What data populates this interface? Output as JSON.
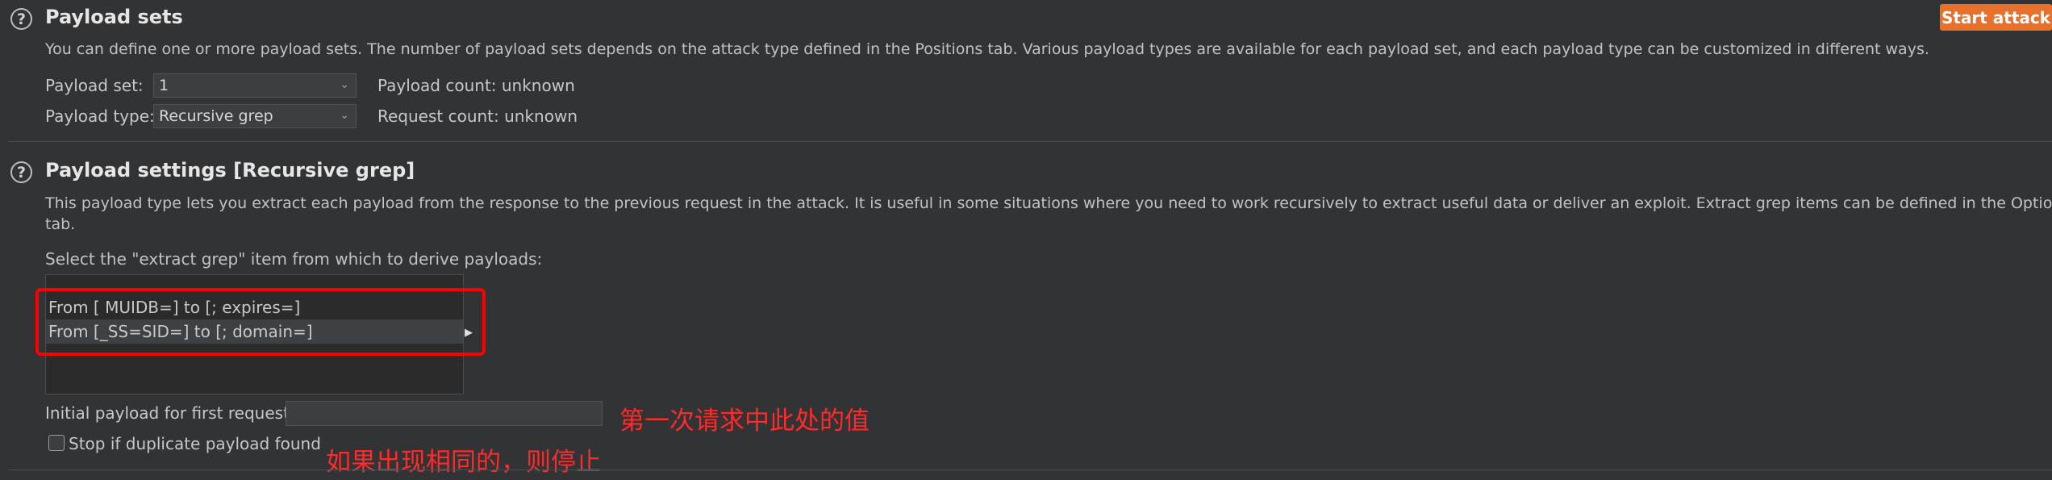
{
  "payload_sets": {
    "help_icon": "question-mark-icon",
    "title": "Payload sets",
    "description": "You can define one or more payload sets. The number of payload sets depends on the attack type defined in the Positions tab. Various payload types are available for each payload set, and each payload type can be customized in different ways.",
    "payload_set_label": "Payload set:",
    "payload_set_value": "1",
    "payload_type_label": "Payload type:",
    "payload_type_value": "Recursive grep",
    "payload_count": "Payload count: unknown",
    "request_count": "Request count: unknown"
  },
  "start_attack_label": "Start attack",
  "payload_settings": {
    "help_icon": "question-mark-icon",
    "title": "Payload settings [Recursive grep]",
    "description_line1": "This payload type lets you extract each payload from the response to the previous request in the attack. It is useful in some situations where you need to work recursively to extract useful data or deliver an exploit. Extract grep items can be defined in the Options",
    "description_line2": "tab.",
    "select_label": "Select the \"extract grep\" item from which to derive payloads:",
    "grep_items": [
      "From [ MUIDB=] to [; expires=]",
      "From [_SS=SID=] to [; domain=]"
    ],
    "initial_payload_label": "Initial payload for first request:",
    "initial_payload_value": "",
    "stop_duplicate_label": "Stop if duplicate payload found",
    "stop_duplicate_checked": false
  },
  "annotations": {
    "initial_value_note": "第一次请求中此处的值",
    "duplicate_note": "如果出现相同的，则停止"
  },
  "colors": {
    "accent": "#e8702a",
    "annotation": "#ff0000",
    "background": "#313335"
  }
}
